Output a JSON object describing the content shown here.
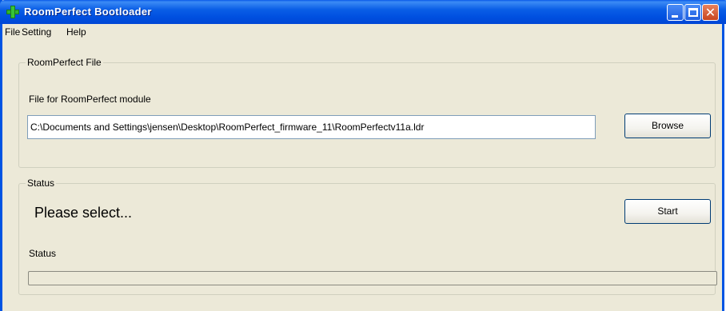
{
  "window": {
    "title": "RoomPerfect Bootloader",
    "close_glyph": "✕"
  },
  "menu": {
    "file": "File",
    "setting": "Setting",
    "help": "Help"
  },
  "file_group": {
    "legend": "RoomPerfect File",
    "label": "File for RoomPerfect module",
    "path_value": "C:\\Documents and Settings\\jensen\\Desktop\\RoomPerfect_firmware_11\\RoomPerfectv11a.ldr",
    "browse_label": "Browse"
  },
  "status_group": {
    "legend": "Status",
    "message": "Please select...",
    "status_label": "Status",
    "start_label": "Start",
    "progress": 0
  },
  "colors": {
    "titlebar": "#0054e3",
    "face": "#ece9d8",
    "close": "#c8451f"
  }
}
